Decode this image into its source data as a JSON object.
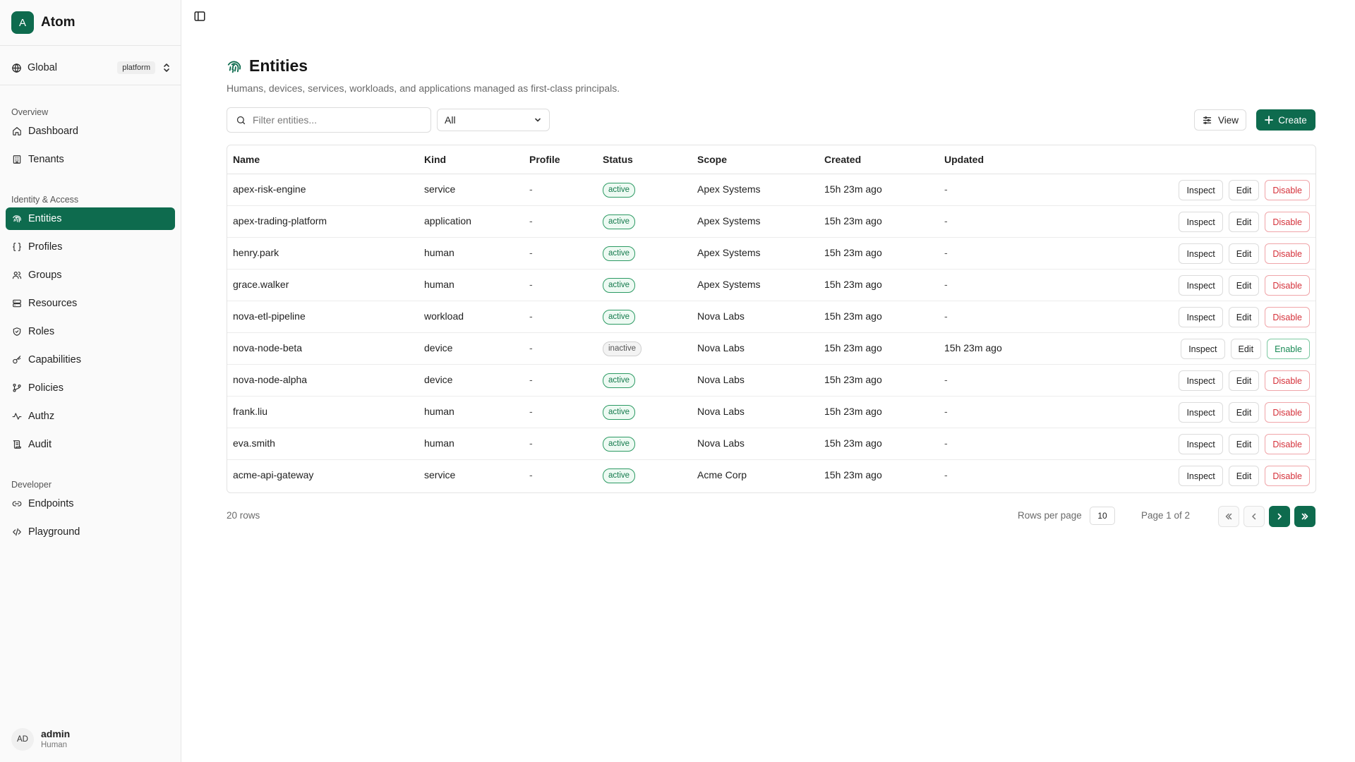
{
  "brand": {
    "logo_letter": "A",
    "name": "Atom"
  },
  "scope": {
    "label": "Global",
    "badge": "platform"
  },
  "sidebar": {
    "sections": [
      {
        "label": "Overview",
        "items": [
          {
            "label": "Dashboard",
            "icon": "home-icon"
          },
          {
            "label": "Tenants",
            "icon": "building-icon"
          }
        ]
      },
      {
        "label": "Identity & Access",
        "items": [
          {
            "label": "Entities",
            "icon": "fingerprint-icon",
            "active": true
          },
          {
            "label": "Profiles",
            "icon": "braces-icon"
          },
          {
            "label": "Groups",
            "icon": "users-icon"
          },
          {
            "label": "Resources",
            "icon": "server-icon"
          },
          {
            "label": "Roles",
            "icon": "shield-icon"
          },
          {
            "label": "Capabilities",
            "icon": "key-icon"
          },
          {
            "label": "Policies",
            "icon": "git-branch-icon"
          },
          {
            "label": "Authz",
            "icon": "activity-icon"
          },
          {
            "label": "Audit",
            "icon": "scroll-icon"
          }
        ]
      },
      {
        "label": "Developer",
        "items": [
          {
            "label": "Endpoints",
            "icon": "link-icon"
          },
          {
            "label": "Playground",
            "icon": "code-icon"
          }
        ]
      }
    ]
  },
  "user": {
    "initials": "AD",
    "name": "admin",
    "role": "Human"
  },
  "page": {
    "title": "Entities",
    "subtitle": "Humans, devices, services, workloads, and applications managed as first-class principals."
  },
  "toolbar": {
    "filter_placeholder": "Filter entities...",
    "kind_filter": "All",
    "view_label": "View",
    "create_label": "Create"
  },
  "table": {
    "columns": [
      "Name",
      "Kind",
      "Profile",
      "Status",
      "Scope",
      "Created",
      "Updated"
    ],
    "rows": [
      {
        "name": "apex-risk-engine",
        "kind": "service",
        "profile": "-",
        "status": "active",
        "scope": "Apex Systems",
        "created": "15h 23m ago",
        "updated": "-",
        "actions": [
          "Inspect",
          "Edit",
          "Disable"
        ]
      },
      {
        "name": "apex-trading-platform",
        "kind": "application",
        "profile": "-",
        "status": "active",
        "scope": "Apex Systems",
        "created": "15h 23m ago",
        "updated": "-",
        "actions": [
          "Inspect",
          "Edit",
          "Disable"
        ]
      },
      {
        "name": "henry.park",
        "kind": "human",
        "profile": "-",
        "status": "active",
        "scope": "Apex Systems",
        "created": "15h 23m ago",
        "updated": "-",
        "actions": [
          "Inspect",
          "Edit",
          "Disable"
        ]
      },
      {
        "name": "grace.walker",
        "kind": "human",
        "profile": "-",
        "status": "active",
        "scope": "Apex Systems",
        "created": "15h 23m ago",
        "updated": "-",
        "actions": [
          "Inspect",
          "Edit",
          "Disable"
        ]
      },
      {
        "name": "nova-etl-pipeline",
        "kind": "workload",
        "profile": "-",
        "status": "active",
        "scope": "Nova Labs",
        "created": "15h 23m ago",
        "updated": "-",
        "actions": [
          "Inspect",
          "Edit",
          "Disable"
        ]
      },
      {
        "name": "nova-node-beta",
        "kind": "device",
        "profile": "-",
        "status": "inactive",
        "scope": "Nova Labs",
        "created": "15h 23m ago",
        "updated": "15h 23m ago",
        "actions": [
          "Inspect",
          "Edit",
          "Enable"
        ]
      },
      {
        "name": "nova-node-alpha",
        "kind": "device",
        "profile": "-",
        "status": "active",
        "scope": "Nova Labs",
        "created": "15h 23m ago",
        "updated": "-",
        "actions": [
          "Inspect",
          "Edit",
          "Disable"
        ]
      },
      {
        "name": "frank.liu",
        "kind": "human",
        "profile": "-",
        "status": "active",
        "scope": "Nova Labs",
        "created": "15h 23m ago",
        "updated": "-",
        "actions": [
          "Inspect",
          "Edit",
          "Disable"
        ]
      },
      {
        "name": "eva.smith",
        "kind": "human",
        "profile": "-",
        "status": "active",
        "scope": "Nova Labs",
        "created": "15h 23m ago",
        "updated": "-",
        "actions": [
          "Inspect",
          "Edit",
          "Disable"
        ]
      },
      {
        "name": "acme-api-gateway",
        "kind": "service",
        "profile": "-",
        "status": "active",
        "scope": "Acme Corp",
        "created": "15h 23m ago",
        "updated": "-",
        "actions": [
          "Inspect",
          "Edit",
          "Disable"
        ]
      }
    ]
  },
  "footer": {
    "row_count": "20 rows",
    "rows_per_page_label": "Rows per page",
    "rows_per_page": "10",
    "page_info": "Page 1 of 2"
  },
  "colors": {
    "accent": "#0e6b4e",
    "danger": "#d5313a",
    "success": "#198a55"
  }
}
